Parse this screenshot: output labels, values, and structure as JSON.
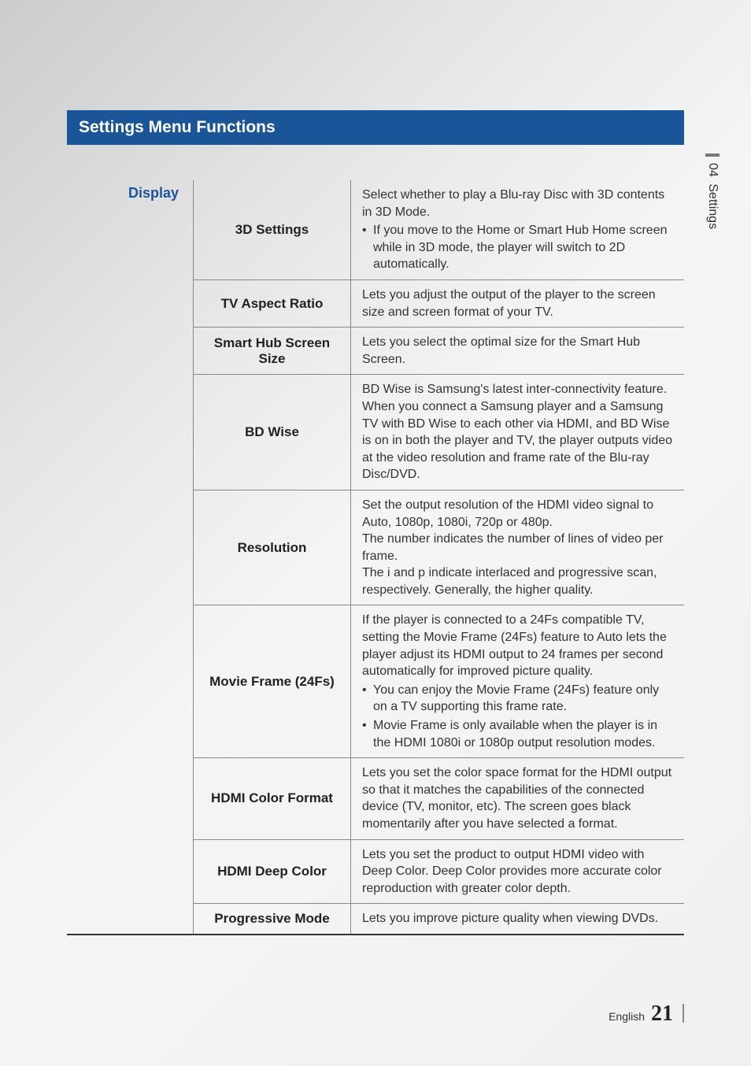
{
  "section_title": "Settings Menu Functions",
  "category_label": "Display",
  "side_tab": {
    "number": "04",
    "label": "Settings"
  },
  "footer": {
    "language": "English",
    "page_number": "21"
  },
  "settings": {
    "three_d": {
      "name": "3D Settings",
      "intro": "Select whether to play a Blu-ray Disc with 3D contents in 3D Mode.",
      "bullet1": "If you move to the Home or Smart Hub Home screen while in 3D mode, the player will switch to 2D automatically."
    },
    "tv_aspect": {
      "name": "TV Aspect Ratio",
      "desc": "Lets you adjust the output of the player to the screen size and screen format of your TV."
    },
    "smart_hub_size": {
      "name": "Smart Hub Screen Size",
      "desc": "Lets you select the optimal size for the Smart Hub Screen."
    },
    "bd_wise": {
      "name": "BD Wise",
      "desc": "BD Wise is Samsung's latest inter-connectivity feature. When you connect a Samsung player and a Samsung TV with BD Wise to each other via HDMI, and BD Wise is on in both the player and TV, the player outputs video at the video resolution and frame rate of the Blu-ray Disc/DVD."
    },
    "resolution": {
      "name": "Resolution",
      "line1": "Set the output resolution of the HDMI video signal to Auto, 1080p, 1080i, 720p or 480p.",
      "line2": "The number indicates the number of lines of video per frame.",
      "line3": "The i and p indicate interlaced and progressive scan, respectively. Generally, the higher quality."
    },
    "movie_frame": {
      "name": "Movie Frame (24Fs)",
      "intro": "If the player is connected to a 24Fs compatible TV, setting the Movie Frame (24Fs) feature to Auto lets the player adjust its HDMI output to 24 frames per second automatically for improved picture quality.",
      "bullet1": "You can enjoy the Movie Frame (24Fs) feature only on a TV supporting this frame rate.",
      "bullet2": "Movie Frame is only available when the player is in the HDMI 1080i or 1080p output resolution modes."
    },
    "hdmi_color": {
      "name": "HDMI Color Format",
      "desc": "Lets you set the color space format for the HDMI output so that it matches the capabilities of the connected device (TV, monitor, etc). The screen goes black momentarily after you have selected a format."
    },
    "hdmi_deep": {
      "name": "HDMI Deep Color",
      "desc": "Lets you set the product to output HDMI video with Deep Color. Deep Color provides more accurate color reproduction with greater color depth."
    },
    "progressive": {
      "name": "Progressive Mode",
      "desc": "Lets you improve picture quality when viewing DVDs."
    }
  }
}
